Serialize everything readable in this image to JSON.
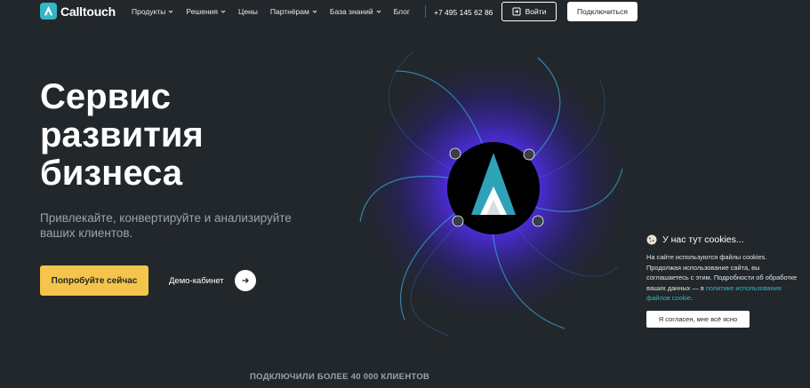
{
  "header": {
    "logo_text": "Calltouch",
    "nav": [
      {
        "label": "Продукты",
        "has_dropdown": true
      },
      {
        "label": "Решения",
        "has_dropdown": true
      },
      {
        "label": "Цены",
        "has_dropdown": false
      },
      {
        "label": "Партнёрам",
        "has_dropdown": true
      },
      {
        "label": "База знаний",
        "has_dropdown": true
      },
      {
        "label": "Блог",
        "has_dropdown": false
      }
    ],
    "phone": "+7 495 145 62 86",
    "login_label": "Войти",
    "connect_label": "Подключиться"
  },
  "hero": {
    "title_lines": [
      "Сервис",
      "развития",
      "бизнеса"
    ],
    "subtitle": "Привлекайте, конвертируйте и анализируйте ваших клиентов.",
    "try_label": "Попробуйте сейчас",
    "demo_label": "Демо-кабинет"
  },
  "clients_text": "ПОДКЛЮЧИЛИ БОЛЕЕ 40 000 КЛИЕНТОВ",
  "cookie": {
    "title": "У нас тут cookies...",
    "text": "На сайте используются файлы cookies. Продолжая использование сайта, вы соглашаетесь с этим. Подробности об обработке ваших данных — в",
    "link": "политике использования файлов cookie",
    "link_suffix": ".",
    "accept_label": "Я согласен, мне всё ясно"
  },
  "colors": {
    "background": "#22272b",
    "accent_yellow": "#f5c54b",
    "brand_teal": "#34b5c8",
    "vortex_purple": "#4b2bd9"
  }
}
